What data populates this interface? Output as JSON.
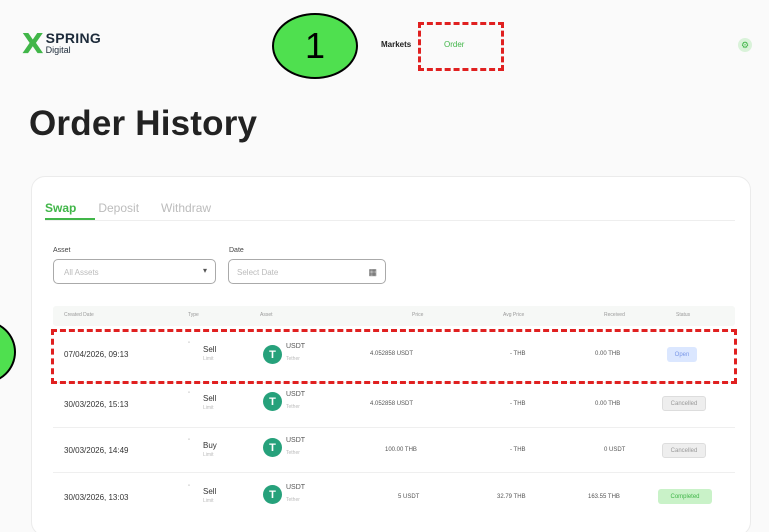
{
  "brand": {
    "mark": "X",
    "name": "SPRING",
    "sub": "Digital"
  },
  "nav": {
    "markets": "Markets",
    "order": "Order"
  },
  "annotations": {
    "step1": "1"
  },
  "page": {
    "title": "Order History"
  },
  "tabs": [
    {
      "label": "Swap",
      "active": true
    },
    {
      "label": "Deposit",
      "active": false
    },
    {
      "label": "Withdraw",
      "active": false
    }
  ],
  "filters": {
    "asset_label": "Asset",
    "asset_value": "All Assets",
    "date_label": "Date",
    "date_placeholder": "Select Date"
  },
  "table": {
    "headers": [
      "Created Date",
      "Type",
      "Asset",
      "Price",
      "Avg Price",
      "Received",
      "Status"
    ],
    "rows": [
      {
        "date": "07/04/2026, 09:13",
        "type": "Sell",
        "type_sub": "Limit",
        "asset": "USDT",
        "asset_sub": "Tether",
        "price": "4.052858 USDT",
        "avg_price": "- THB",
        "received": "0.00 THB",
        "status": "Open",
        "status_kind": "open"
      },
      {
        "date": "30/03/2026, 15:13",
        "type": "Sell",
        "type_sub": "Limit",
        "asset": "USDT",
        "asset_sub": "Tether",
        "price": "4.052858 USDT",
        "avg_price": "- THB",
        "received": "0.00 THB",
        "status": "Cancelled",
        "status_kind": "cancel"
      },
      {
        "date": "30/03/2026, 14:49",
        "type": "Buy",
        "type_sub": "Limit",
        "asset": "USDT",
        "asset_sub": "Tether",
        "price": "100.00 THB",
        "avg_price": "- THB",
        "received": "0 USDT",
        "status": "Cancelled",
        "status_kind": "cancel"
      },
      {
        "date": "30/03/2026, 13:03",
        "type": "Sell",
        "type_sub": "Limit",
        "asset": "USDT",
        "asset_sub": "Tether",
        "price": "5 USDT",
        "avg_price": "32.79 THB",
        "received": "163.55 THB",
        "status": "Completed",
        "status_kind": "done"
      }
    ]
  },
  "colors": {
    "brand_green": "#41b649",
    "annotation_red": "#e02020",
    "annotation_bubble": "#4fe04f",
    "tether": "#26a17b"
  }
}
